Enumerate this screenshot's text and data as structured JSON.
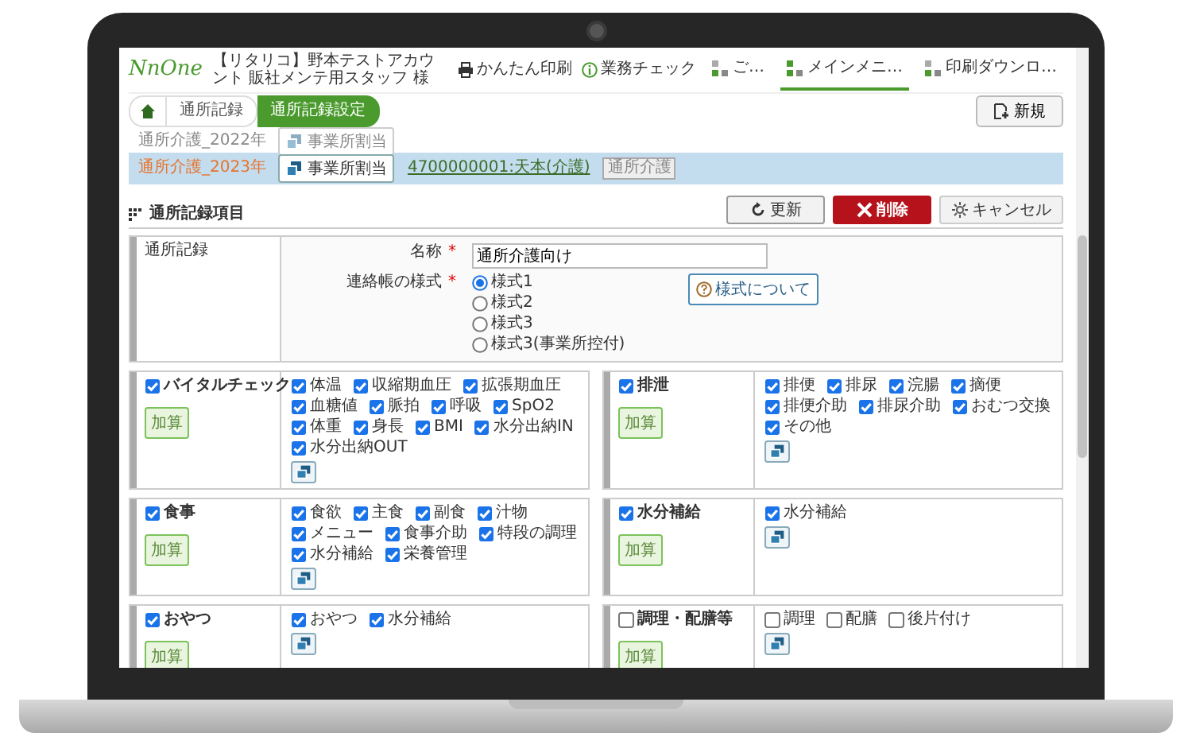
{
  "header": {
    "logo": "NnOne",
    "account": "【リタリコ】野本テストアカウント 販社メンテ用スタッフ 様",
    "links": [
      {
        "label": "かんたん印刷",
        "kind": "print"
      },
      {
        "label": "業務チェック",
        "kind": "info"
      }
    ],
    "tabs": [
      {
        "label": "ご…",
        "selected": false
      },
      {
        "label": "メインメニ…",
        "selected": true
      },
      {
        "label": "印刷ダウンロ…",
        "selected": false
      }
    ]
  },
  "breadcrumb": [
    {
      "label": "通所記録",
      "selected": false
    },
    {
      "label": "通所記録設定",
      "selected": true
    }
  ],
  "new_button": "新規",
  "records": [
    {
      "name": "通所介護_2022年",
      "assign_button": "事業所割当",
      "selected": false,
      "faded": true
    },
    {
      "name": "通所介護_2023年",
      "assign_button": "事業所割当",
      "office_link": "4700000001:天本(介護)",
      "tag": "通所介護",
      "selected": true,
      "faded": false
    }
  ],
  "section": {
    "title": "通所記録項目",
    "buttons": [
      {
        "label": "更新",
        "kind": "refresh"
      },
      {
        "label": "削除",
        "kind": "delete"
      },
      {
        "label": "キャンセル",
        "kind": "cancel"
      }
    ]
  },
  "basic": {
    "label": "通所記録",
    "name_label": "名称",
    "name_required_mark": "*",
    "name_value": "通所介護向け",
    "format_label": "連絡帳の様式",
    "format_required_mark": "*",
    "format_options": [
      {
        "label": "様式1",
        "selected": true
      },
      {
        "label": "様式2",
        "selected": false
      },
      {
        "label": "様式3",
        "selected": false
      },
      {
        "label": "様式3(事業所控付)",
        "selected": false
      }
    ],
    "help_button": "様式について"
  },
  "groups": [
    {
      "title": "バイタルチェック",
      "checked": true,
      "add_button": "加算",
      "items": [
        {
          "label": "体温",
          "checked": true
        },
        {
          "label": "収縮期血圧",
          "checked": true
        },
        {
          "label": "拡張期血圧",
          "checked": true
        },
        {
          "label": "血糖値",
          "checked": true
        },
        {
          "label": "脈拍",
          "checked": true
        },
        {
          "label": "呼吸",
          "checked": true
        },
        {
          "label": "SpO2",
          "checked": true
        },
        {
          "label": "体重",
          "checked": true
        },
        {
          "label": "身長",
          "checked": true
        },
        {
          "label": "BMI",
          "checked": true
        },
        {
          "label": "水分出納IN",
          "checked": true
        },
        {
          "label": "水分出納OUT",
          "checked": true
        }
      ]
    },
    {
      "title": "排泄",
      "checked": true,
      "add_button": "加算",
      "items": [
        {
          "label": "排便",
          "checked": true
        },
        {
          "label": "排尿",
          "checked": true
        },
        {
          "label": "浣腸",
          "checked": true
        },
        {
          "label": "摘便",
          "checked": true
        },
        {
          "label": "排便介助",
          "checked": true
        },
        {
          "label": "排尿介助",
          "checked": true
        },
        {
          "label": "おむつ交換",
          "checked": true
        },
        {
          "label": "その他",
          "checked": true
        }
      ]
    },
    {
      "title": "食事",
      "checked": true,
      "add_button": "加算",
      "items": [
        {
          "label": "食欲",
          "checked": true
        },
        {
          "label": "主食",
          "checked": true
        },
        {
          "label": "副食",
          "checked": true
        },
        {
          "label": "汁物",
          "checked": true
        },
        {
          "label": "メニュー",
          "checked": true
        },
        {
          "label": "食事介助",
          "checked": true
        },
        {
          "label": "特段の調理",
          "checked": true
        },
        {
          "label": "水分補給",
          "checked": true
        },
        {
          "label": "栄養管理",
          "checked": true
        }
      ]
    },
    {
      "title": "水分補給",
      "checked": true,
      "add_button": "加算",
      "items": [
        {
          "label": "水分補給",
          "checked": true
        }
      ]
    },
    {
      "title": "おやつ",
      "checked": true,
      "add_button": "加算",
      "items": [
        {
          "label": "おやつ",
          "checked": true
        },
        {
          "label": "水分補給",
          "checked": true
        }
      ]
    },
    {
      "title": "調理・配膳等",
      "checked": false,
      "add_button": "加算",
      "items": [
        {
          "label": "調理",
          "checked": false
        },
        {
          "label": "配膳",
          "checked": false
        },
        {
          "label": "後片付け",
          "checked": false
        }
      ]
    }
  ]
}
